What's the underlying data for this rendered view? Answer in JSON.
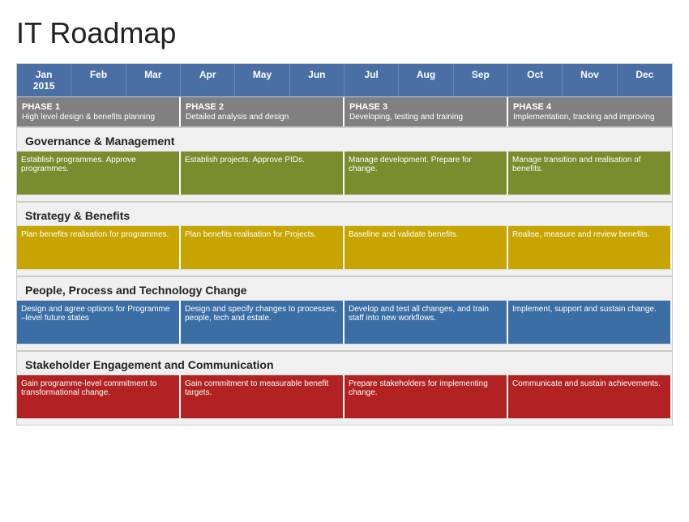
{
  "title": "IT Roadmap",
  "months": [
    {
      "label": "Jan\n2015"
    },
    {
      "label": "Feb"
    },
    {
      "label": "Mar"
    },
    {
      "label": "Apr"
    },
    {
      "label": "May"
    },
    {
      "label": "Jun"
    },
    {
      "label": "Jul"
    },
    {
      "label": "Aug"
    },
    {
      "label": "Sep"
    },
    {
      "label": "Oct"
    },
    {
      "label": "Nov"
    },
    {
      "label": "Dec"
    }
  ],
  "phases": [
    {
      "title": "PHASE 1",
      "subtitle": "High level design & benefits planning",
      "span": 3
    },
    {
      "title": "PHASE 2",
      "subtitle": "Detailed analysis and design",
      "span": 3
    },
    {
      "title": "PHASE 3",
      "subtitle": "Developing, testing and training",
      "span": 3
    },
    {
      "title": "PHASE 4",
      "subtitle": "Implementation, tracking and improving",
      "span": 3
    }
  ],
  "sections": [
    {
      "title": "Governance & Management",
      "activities": [
        {
          "text": "Establish programmes. Approve programmes.",
          "span": 3,
          "color": "olive",
          "startCol": 1
        },
        {
          "text": "Establish projects. Approve PIDs.",
          "span": 3,
          "color": "olive",
          "startCol": 4
        },
        {
          "text": "Manage development. Prepare for change.",
          "span": 3,
          "color": "olive",
          "startCol": 7
        },
        {
          "text": "Manage transition and realisation of benefits.",
          "span": 3,
          "color": "olive",
          "startCol": 10
        }
      ]
    },
    {
      "title": "Strategy & Benefits",
      "activities": [
        {
          "text": "Plan benefits realisation for programmes.",
          "span": 3,
          "color": "gold",
          "startCol": 1
        },
        {
          "text": "Plan benefits realisation for Projects.",
          "span": 3,
          "color": "gold",
          "startCol": 4
        },
        {
          "text": "Baseline and validate benefits.",
          "span": 3,
          "color": "gold",
          "startCol": 7
        },
        {
          "text": "Realise, measure and review benefits.",
          "span": 3,
          "color": "gold",
          "startCol": 10
        }
      ]
    },
    {
      "title": "People, Process and Technology Change",
      "activities": [
        {
          "text": "Design and agree options for Programme –level future states",
          "span": 3,
          "color": "blue",
          "startCol": 1
        },
        {
          "text": "Design and specify changes to processes, people, tech and estate.",
          "span": 3,
          "color": "blue",
          "startCol": 4
        },
        {
          "text": "Develop and test all changes, and train staff into new workflows.",
          "span": 3,
          "color": "blue",
          "startCol": 7
        },
        {
          "text": "Implement, support and sustain change.",
          "span": 3,
          "color": "blue",
          "startCol": 10
        }
      ]
    },
    {
      "title": "Stakeholder Engagement and Communication",
      "activities": [
        {
          "text": "Gain programme-level commitment to transformational change.",
          "span": 3,
          "color": "red",
          "startCol": 1
        },
        {
          "text": "Gain commitment to measurable benefit targets.",
          "span": 3,
          "color": "red",
          "startCol": 4
        },
        {
          "text": "Prepare stakeholders for implementing change.",
          "span": 3,
          "color": "red",
          "startCol": 7
        },
        {
          "text": "Communicate and sustain achievements.",
          "span": 3,
          "color": "red",
          "startCol": 10
        }
      ]
    }
  ]
}
